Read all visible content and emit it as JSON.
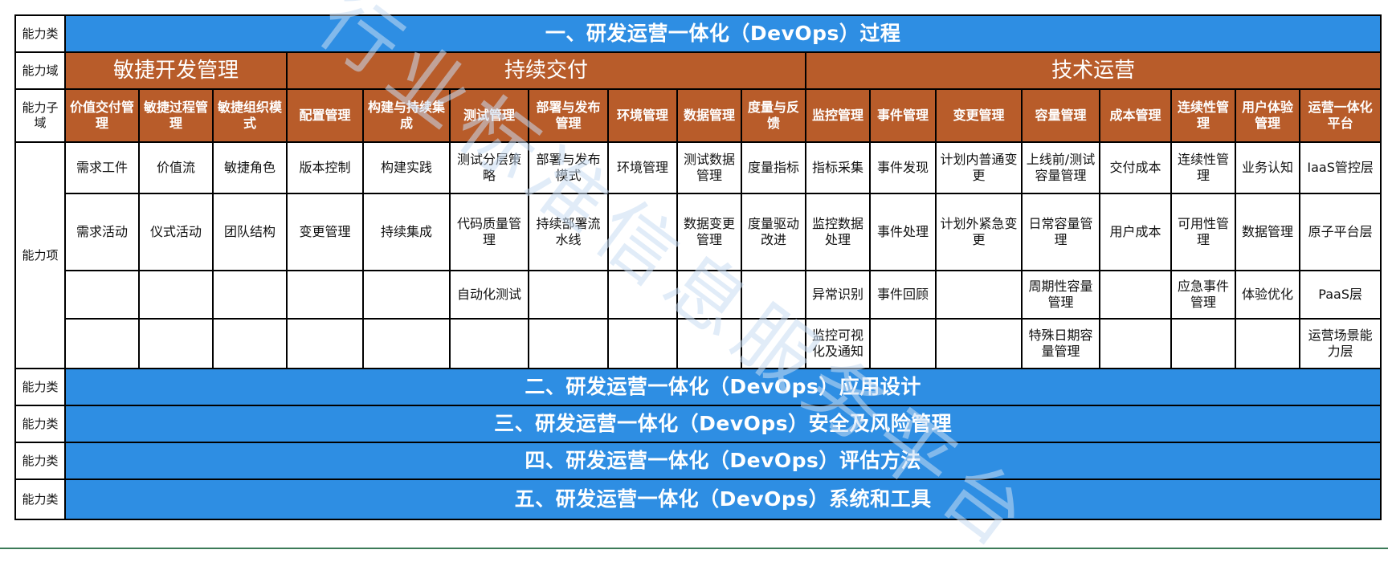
{
  "row_label_category": "能力类",
  "row_label_domain": "能力域",
  "row_label_subdomain": "能力子域",
  "row_label_items": "能力项",
  "categories": [
    "一、研发运营一体化（DevOps）过程",
    "二、研发运营一体化（DevOps）应用设计",
    "三、研发运营一体化（DevOps）安全及风险管理",
    "四、研发运营一体化（DevOps）评估方法",
    "五、研发运营一体化（DevOps）系统和工具"
  ],
  "domains": [
    "敏捷开发管理",
    "持续交付",
    "技术运营"
  ],
  "subdomains": [
    "价值交付管理",
    "敏捷过程管理",
    "敏捷组织模式",
    "配置管理",
    "构建与持续集成",
    "测试管理",
    "部署与发布管理",
    "环境管理",
    "数据管理",
    "度量与反馈",
    "监控管理",
    "事件管理",
    "变更管理",
    "容量管理",
    "成本管理",
    "连续性管理",
    "用户体验管理",
    "运营一体化平台"
  ],
  "items": [
    [
      "需求工件",
      "价值流",
      "敏捷角色",
      "版本控制",
      "构建实践",
      "测试分层策略",
      "部署与发布模式",
      "环境管理",
      "测试数据管理",
      "度量指标",
      "指标采集",
      "事件发现",
      "计划内普通变更",
      "上线前/测试容量管理",
      "交付成本",
      "连续性管理",
      "业务认知",
      "IaaS管控层"
    ],
    [
      "需求活动",
      "仪式活动",
      "团队结构",
      "变更管理",
      "持续集成",
      "代码质量管理",
      "持续部署流水线",
      "",
      "数据变更管理",
      "度量驱动改进",
      "监控数据处理",
      "事件处理",
      "计划外紧急变更",
      "日常容量管理",
      "用户成本",
      "可用性管理",
      "数据管理",
      "原子平台层"
    ],
    [
      "",
      "",
      "",
      "",
      "",
      "自动化测试",
      "",
      "",
      "",
      "",
      "异常识别",
      "事件回顾",
      "",
      "周期性容量管理",
      "",
      "应急事件管理",
      "体验优化",
      "PaaS层"
    ],
    [
      "",
      "",
      "",
      "",
      "",
      "",
      "",
      "",
      "",
      "",
      "监控可视化及通知",
      "",
      "",
      "特殊日期容量管理",
      "",
      "",
      "",
      "运营场景能力层"
    ]
  ],
  "watermark": "行业标准信息服务平台",
  "colors": {
    "category_blue": "#2e8ee3",
    "domain_brown": "#b85c2a"
  }
}
